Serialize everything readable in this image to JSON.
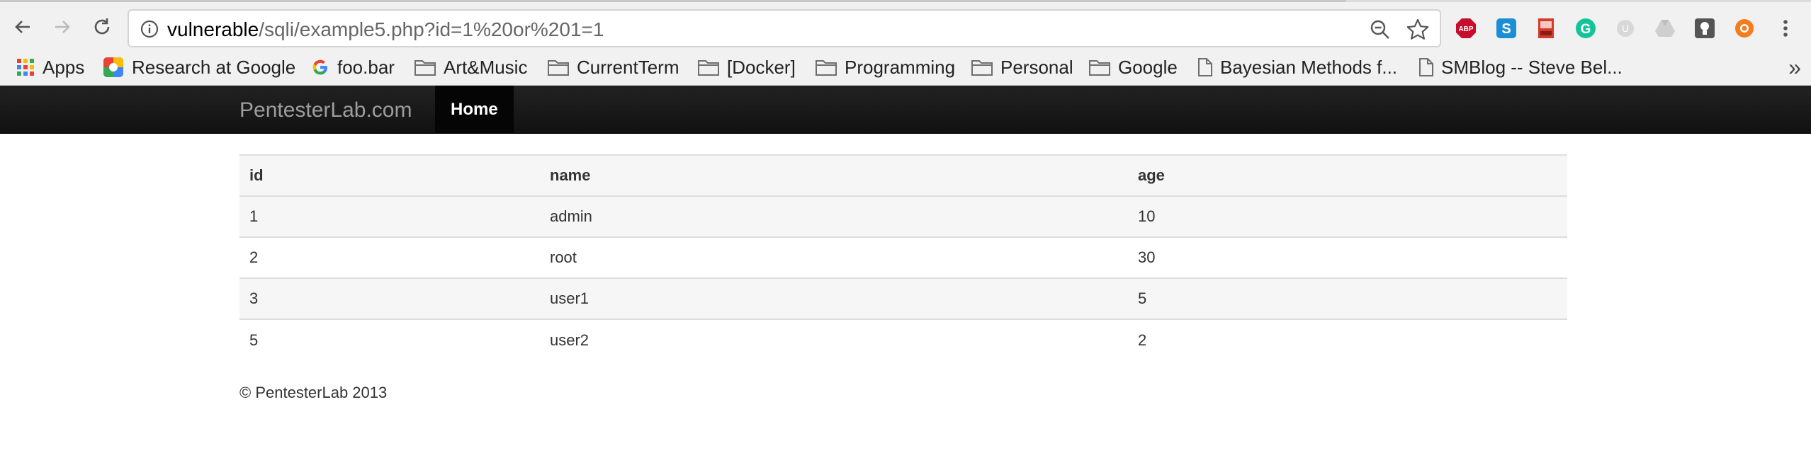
{
  "browser": {
    "url_host": "vulnerable",
    "url_path": "/sqli/example5.php?id=1%20or%201=1",
    "extensions": [
      "adblock-plus-icon",
      "skype-icon",
      "pdf-icon",
      "grammarly-icon",
      "extension-icon",
      "google-drive-icon",
      "lightbulb-icon",
      "lifebuoy-icon",
      "menu-dots-icon"
    ]
  },
  "bookmarks": {
    "items": [
      {
        "label": "Apps",
        "icon": "apps-grid-icon"
      },
      {
        "label": "Research at Google",
        "icon": "google-multicolor-icon"
      },
      {
        "label": "foo.bar",
        "icon": "google-g-icon"
      },
      {
        "label": "Art&Music",
        "icon": "folder-icon"
      },
      {
        "label": "CurrentTerm",
        "icon": "folder-icon"
      },
      {
        "label": "[Docker]",
        "icon": "folder-icon"
      },
      {
        "label": "Programming",
        "icon": "folder-icon"
      },
      {
        "label": "Personal",
        "icon": "folder-icon"
      },
      {
        "label": "Google",
        "icon": "folder-icon"
      },
      {
        "label": "Bayesian Methods f...",
        "icon": "page-icon"
      },
      {
        "label": "SMBlog -- Steve Bel...",
        "icon": "page-icon"
      }
    ],
    "more": "»"
  },
  "navbar": {
    "brand": "PentesterLab.com",
    "home": "Home"
  },
  "table": {
    "headers": [
      "id",
      "name",
      "age"
    ],
    "rows": [
      [
        "1",
        "admin",
        "10"
      ],
      [
        "2",
        "root",
        "30"
      ],
      [
        "3",
        "user1",
        "5"
      ],
      [
        "5",
        "user2",
        "2"
      ]
    ]
  },
  "footer": "© PentesterLab 2013",
  "colors": {
    "navbar_bg": "#111111",
    "chrome_bg": "#f1f1f1",
    "stripe_bg": "#f6f6f6"
  }
}
